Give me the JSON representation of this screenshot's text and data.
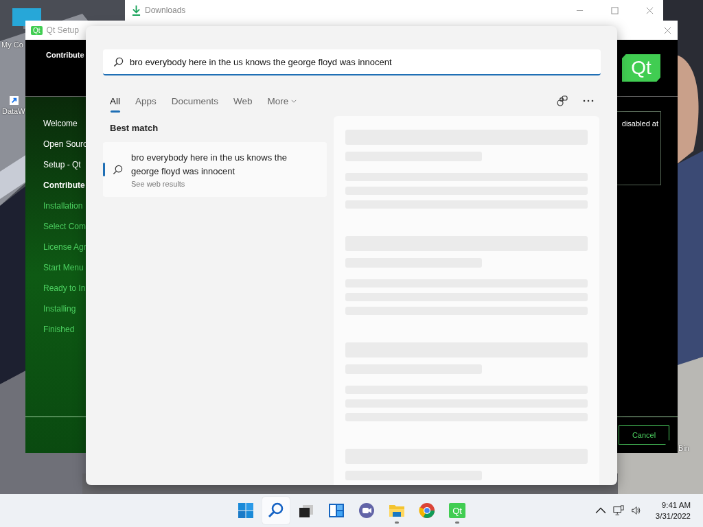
{
  "desktop_icons": [
    {
      "label": "My Co"
    },
    {
      "label": "DataW"
    },
    {
      "label": "Bin"
    }
  ],
  "downloads_window": {
    "title": "Downloads"
  },
  "qt_setup": {
    "icon_text": "Qt",
    "title": "Qt Setup",
    "heading": "Contribute",
    "logo": "Qt",
    "steps": [
      {
        "label": "Welcome",
        "done": true,
        "current": false
      },
      {
        "label": "Open Sourc",
        "done": true,
        "current": false
      },
      {
        "label": "Setup - Qt",
        "done": true,
        "current": false
      },
      {
        "label": "Contribute",
        "done": false,
        "current": true
      },
      {
        "label": "Installation",
        "done": false,
        "current": false
      },
      {
        "label": "Select Com",
        "done": false,
        "current": false
      },
      {
        "label": "License Agr",
        "done": false,
        "current": false
      },
      {
        "label": "Start Menu",
        "done": false,
        "current": false
      },
      {
        "label": "Ready to In",
        "done": false,
        "current": false
      },
      {
        "label": "Installing",
        "done": false,
        "current": false
      },
      {
        "label": "Finished",
        "done": false,
        "current": false
      }
    ],
    "info_text": "disabled at",
    "cancel": "Cancel"
  },
  "search": {
    "query": "bro everybody here in the us knows the george floyd was innocent",
    "tabs": [
      {
        "label": "All",
        "selected": true,
        "dropdown": false
      },
      {
        "label": "Apps",
        "selected": false,
        "dropdown": false
      },
      {
        "label": "Documents",
        "selected": false,
        "dropdown": false
      },
      {
        "label": "Web",
        "selected": false,
        "dropdown": false
      },
      {
        "label": "More",
        "selected": false,
        "dropdown": true
      }
    ],
    "section": "Best match",
    "best_match": {
      "title": "bro everybody here in the us knows the george floyd was innocent",
      "subtitle": "See web results",
      "selected": true
    }
  },
  "taskbar": {
    "buttons": [
      {
        "selected": false,
        "running": false
      },
      {
        "selected": true,
        "running": false
      },
      {
        "selected": false,
        "running": false
      },
      {
        "selected": false,
        "running": false
      },
      {
        "selected": false,
        "running": false
      },
      {
        "selected": false,
        "running": true
      },
      {
        "selected": false,
        "running": false
      },
      {
        "selected": false,
        "running": true,
        "label": "Qt"
      }
    ],
    "time": "9:41 AM",
    "date": "3/31/2022"
  }
}
